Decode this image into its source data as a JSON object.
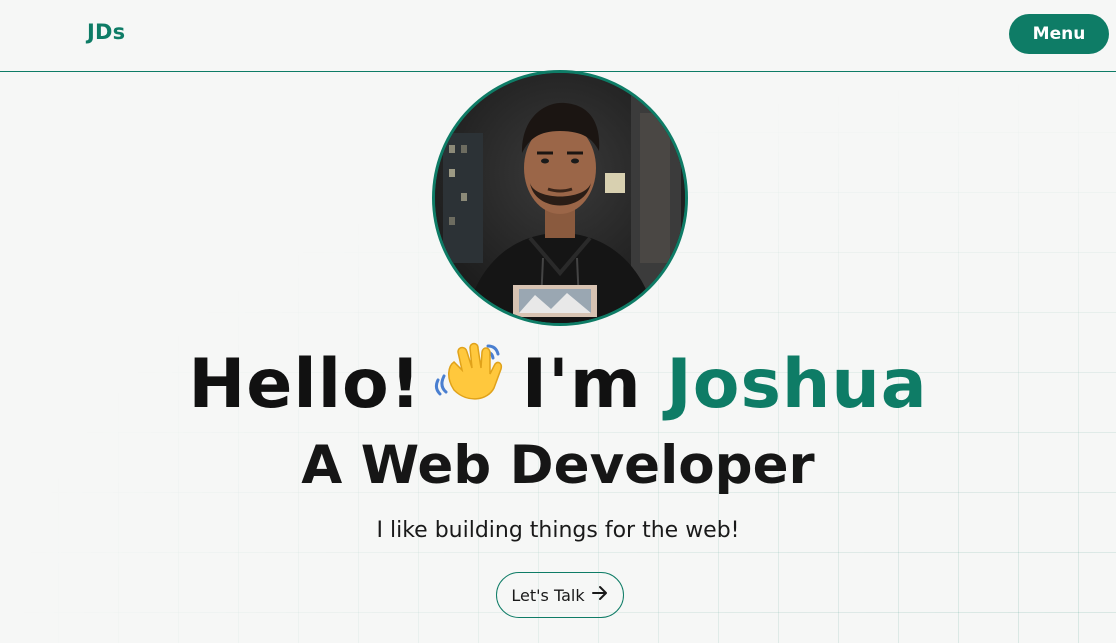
{
  "header": {
    "logo": "JDs",
    "menu_label": "Menu"
  },
  "hero": {
    "greeting": "Hello!",
    "wave_emoji_icon": "waving-hand-icon",
    "intro": "I'm",
    "name": "Joshua",
    "role": "A Web Developer",
    "tagline": "I like building things for the web!",
    "cta_label": "Let's Talk",
    "cta_icon": "arrow-right-icon"
  },
  "colors": {
    "accent": "#0e7c66",
    "background": "#f6f7f6",
    "text": "#111111"
  }
}
